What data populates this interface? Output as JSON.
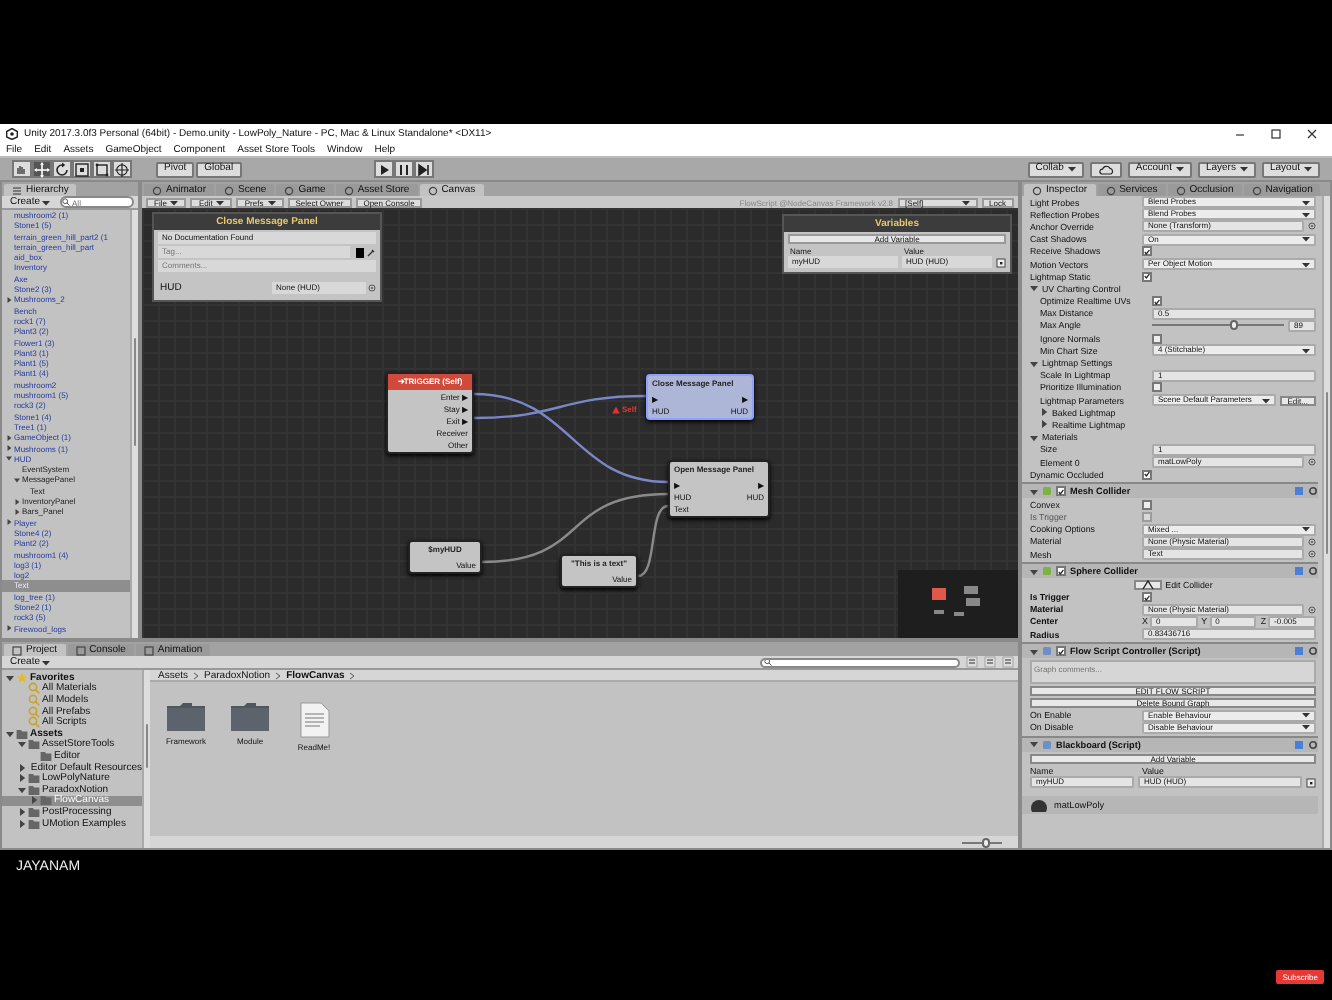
{
  "window": {
    "title": "Unity 2017.3.0f3 Personal (64bit) - Demo.unity - LowPoly_Nature - PC, Mac & Linux Standalone* <DX11>"
  },
  "menu": [
    "File",
    "Edit",
    "Assets",
    "GameObject",
    "Component",
    "Asset Store Tools",
    "Window",
    "Help"
  ],
  "toolbar": {
    "tools": [
      {
        "kind": "hand",
        "selected": false
      },
      {
        "kind": "move",
        "selected": true
      },
      {
        "kind": "rotate",
        "selected": false
      },
      {
        "kind": "scale",
        "selected": false
      },
      {
        "kind": "rect",
        "selected": false
      },
      {
        "kind": "transform",
        "selected": false
      }
    ],
    "toggles": [
      "Pivot",
      "Global"
    ],
    "menus": [
      "Collab",
      "Account",
      "Layers",
      "Layout"
    ]
  },
  "hierarchy": {
    "tab": "Hierarchy",
    "create": "Create",
    "search_placeholder": "All",
    "items": [
      {
        "label": "mushroom2 (1)",
        "selected": false
      },
      {
        "label": "Stone1 (5)",
        "selected": false
      },
      {
        "label": "terrain_green_hill_part2 (1",
        "selected": false
      },
      {
        "label": "terrain_green_hill_part",
        "selected": false
      },
      {
        "label": "aid_box",
        "selected": false
      },
      {
        "label": "Inventory",
        "selected": false
      },
      {
        "label": "Axe",
        "selected": false
      },
      {
        "label": "Stone2 (3)",
        "selected": false
      },
      {
        "label": "Mushrooms_2",
        "selected": false,
        "expanded": false
      },
      {
        "label": "Bench",
        "selected": false
      },
      {
        "label": "rock1 (7)",
        "selected": false
      },
      {
        "label": "Plant3 (2)",
        "selected": false
      },
      {
        "label": "Flower1 (3)",
        "selected": false
      },
      {
        "label": "Plant3 (1)",
        "selected": false
      },
      {
        "label": "Plant1 (5)",
        "selected": false
      },
      {
        "label": "Plant1 (4)",
        "selected": false
      },
      {
        "label": "mushroom2",
        "selected": false
      },
      {
        "label": "mushroom1 (5)",
        "selected": false
      },
      {
        "label": "rock3 (2)",
        "selected": false
      },
      {
        "label": "Stone1 (4)",
        "selected": false
      },
      {
        "label": "Tree1 (1)",
        "selected": false
      },
      {
        "label": "GameObject (1)",
        "selected": false,
        "expanded": false
      },
      {
        "label": "Mushrooms (1)",
        "selected": false,
        "expanded": false
      },
      {
        "label": "HUD",
        "selected": false,
        "expanded": true,
        "children": [
          {
            "label": "EventSystem",
            "selected": false
          },
          {
            "label": "MessagePanel",
            "selected": false,
            "expanded": true,
            "children": [
              {
                "label": "Text",
                "selected": false
              }
            ]
          },
          {
            "label": "InventoryPanel",
            "selected": false,
            "expanded": false
          },
          {
            "label": "Bars_Panel",
            "selected": false,
            "expanded": false
          }
        ]
      },
      {
        "label": "Player",
        "selected": false,
        "expanded": false
      },
      {
        "label": "Stone4 (2)",
        "selected": false
      },
      {
        "label": "Plant2 (2)",
        "selected": false
      },
      {
        "label": "mushroom1 (4)",
        "selected": false
      },
      {
        "label": "log3 (1)",
        "selected": false
      },
      {
        "label": "log2",
        "selected": false
      },
      {
        "label": "Text",
        "selected": true
      },
      {
        "label": "log_tree (1)",
        "selected": false
      },
      {
        "label": "Stone2 (1)",
        "selected": false
      },
      {
        "label": "rock3 (5)",
        "selected": false
      },
      {
        "label": "Firewood_logs",
        "selected": false,
        "expanded": false
      }
    ]
  },
  "canvas": {
    "tabs": [
      {
        "label": "Animator",
        "selected": false
      },
      {
        "label": "Scene",
        "selected": false
      },
      {
        "label": "Game",
        "selected": false
      },
      {
        "label": "Asset Store",
        "selected": false
      },
      {
        "label": "Canvas",
        "selected": true
      }
    ],
    "menu": [
      "File",
      "Edit",
      "Prefs",
      "Select Owner",
      "Open Console"
    ],
    "graph_info": "FlowScript @NodeCanvas Framework v2.8",
    "owner": "[Self]",
    "lock": "Lock",
    "node_inspector": {
      "title": "Close Message Panel",
      "doc": "No Documentation Found",
      "tag_placeholder": "Tag...",
      "comments_placeholder": "Comments...",
      "param_label": "HUD",
      "param_value": "None (HUD)"
    },
    "variables": {
      "title": "Variables",
      "add": "Add Variable",
      "headers": [
        "Name",
        "Value"
      ],
      "rows": [
        {
          "name": "myHUD",
          "value": "HUD (HUD)"
        }
      ]
    },
    "nodes": [
      {
        "kind": "event",
        "title": "➔TRIGGER (Self)",
        "selected": false,
        "rows": [
          {
            "right": "Enter ▶"
          },
          {
            "right": "Stay ▶"
          },
          {
            "right": "Exit ▶"
          },
          {
            "right": "Receiver"
          },
          {
            "right": "Other"
          }
        ]
      },
      {
        "kind": "action",
        "title": "Close Message Panel",
        "selected": true,
        "error": "Self",
        "rows": [
          {
            "left": "▶",
            "right": "▶"
          },
          {
            "left": "HUD",
            "right": "HUD"
          }
        ]
      },
      {
        "kind": "action",
        "title": "Open Message Panel",
        "selected": false,
        "rows": [
          {
            "left": "▶",
            "right": "▶"
          },
          {
            "left": "HUD",
            "right": "HUD"
          },
          {
            "left": "Text"
          }
        ]
      },
      {
        "kind": "value",
        "title": "$myHUD",
        "selected": false,
        "rows": [
          {
            "right": "Value"
          }
        ]
      },
      {
        "kind": "value",
        "title": "\"This is a text\"",
        "selected": false,
        "rows": [
          {
            "right": "Value"
          }
        ]
      }
    ]
  },
  "project": {
    "tabs": [
      {
        "label": "Project",
        "selected": true
      },
      {
        "label": "Console",
        "selected": false
      },
      {
        "label": "Animation",
        "selected": false
      }
    ],
    "create": "Create",
    "tree": [
      {
        "label": "Favorites",
        "kind": "favorites",
        "expanded": true,
        "selected": false,
        "children": [
          {
            "label": "All Materials",
            "kind": "search",
            "selected": false
          },
          {
            "label": "All Models",
            "kind": "search",
            "selected": false
          },
          {
            "label": "All Prefabs",
            "kind": "search",
            "selected": false
          },
          {
            "label": "All Scripts",
            "kind": "search",
            "selected": false
          }
        ]
      },
      {
        "label": "Assets",
        "kind": "folder",
        "expanded": true,
        "selected": false,
        "children": [
          {
            "label": "AssetStoreTools",
            "kind": "folder",
            "expanded": true,
            "selected": false,
            "children": [
              {
                "label": "Editor",
                "kind": "folder",
                "selected": false
              }
            ]
          },
          {
            "label": "Editor Default Resources",
            "kind": "folder",
            "expanded": false,
            "selected": false
          },
          {
            "label": "LowPolyNature",
            "kind": "folder",
            "expanded": false,
            "selected": false
          },
          {
            "label": "ParadoxNotion",
            "kind": "folder",
            "expanded": true,
            "selected": false,
            "children": [
              {
                "label": "FlowCanvas",
                "kind": "folder",
                "expanded": false,
                "selected": true
              }
            ]
          },
          {
            "label": "PostProcessing",
            "kind": "folder",
            "expanded": false,
            "selected": false
          },
          {
            "label": "UMotion Examples",
            "kind": "folder",
            "expanded": false,
            "selected": false
          }
        ]
      }
    ],
    "breadcrumb": [
      "Assets",
      "ParadoxNotion",
      "FlowCanvas"
    ],
    "files": [
      {
        "name": "Framework",
        "kind": "folder"
      },
      {
        "name": "Module",
        "kind": "folder"
      },
      {
        "name": "ReadMe!",
        "kind": "document"
      }
    ],
    "icon_size": {
      "level": 0.6
    }
  },
  "inspector": {
    "tabs": [
      {
        "label": "Inspector",
        "selected": true
      },
      {
        "label": "Services",
        "selected": false
      },
      {
        "label": "Occlusion",
        "selected": false
      },
      {
        "label": "Navigation",
        "selected": false
      }
    ],
    "rows": [
      {
        "kind": "dropdown",
        "label": "Light Probes",
        "value": "Blend Probes"
      },
      {
        "kind": "dropdown",
        "label": "Reflection Probes",
        "value": "Blend Probes"
      },
      {
        "kind": "object",
        "label": "Anchor Override",
        "value": "None (Transform)"
      },
      {
        "kind": "dropdown",
        "label": "Cast Shadows",
        "value": "On"
      },
      {
        "kind": "check",
        "label": "Receive Shadows",
        "checked": true
      },
      {
        "kind": "dropdown",
        "label": "Motion Vectors",
        "value": "Per Object Motion"
      },
      {
        "kind": "check",
        "label": "Lightmap Static",
        "checked": true
      },
      {
        "kind": "foldout",
        "label": "UV Charting Control",
        "expanded": true,
        "children": [
          {
            "kind": "check",
            "label": "Optimize Realtime UVs",
            "checked": true
          },
          {
            "kind": "field",
            "label": "Max Distance",
            "value": "0.5"
          },
          {
            "kind": "slider",
            "label": "Max Angle",
            "value": "89",
            "level": 0.62
          },
          {
            "kind": "check",
            "label": "Ignore Normals",
            "checked": false
          },
          {
            "kind": "dropdown",
            "label": "Min Chart Size",
            "value": "4 (Stitchable)"
          }
        ]
      },
      {
        "kind": "foldout",
        "label": "Lightmap Settings",
        "expanded": true,
        "children": [
          {
            "kind": "field",
            "label": "Scale In Lightmap",
            "value": "1"
          },
          {
            "kind": "check",
            "label": "Prioritize Illumination",
            "checked": false
          },
          {
            "kind": "dropdown",
            "label": "Lightmap Parameters",
            "value": "Scene Default Parameters",
            "button": "Edit..."
          },
          {
            "kind": "foldout",
            "label": "Baked Lightmap",
            "expanded": false
          },
          {
            "kind": "foldout",
            "label": "Realtime Lightmap",
            "expanded": false
          }
        ]
      },
      {
        "kind": "foldout",
        "label": "Materials",
        "expanded": true,
        "children": [
          {
            "kind": "field",
            "label": "Size",
            "value": "1"
          },
          {
            "kind": "object",
            "label": "Element 0",
            "value": "matLowPoly"
          }
        ]
      },
      {
        "kind": "check",
        "label": "Dynamic Occluded",
        "checked": true
      },
      {
        "kind": "component",
        "label": "Mesh Collider",
        "enabled": true,
        "children": [
          {
            "kind": "check",
            "label": "Convex",
            "checked": false
          },
          {
            "kind": "check",
            "label": "Is Trigger",
            "checked": false,
            "disabled": true
          },
          {
            "kind": "dropdown",
            "label": "Cooking Options",
            "value": "Mixed ..."
          },
          {
            "kind": "object",
            "label": "Material",
            "value": "None (Physic Material)"
          },
          {
            "kind": "object",
            "label": "Mesh",
            "value": "Text"
          }
        ]
      },
      {
        "kind": "component",
        "label": "Sphere Collider",
        "enabled": true,
        "children": [
          {
            "kind": "edit",
            "label": "Edit Collider"
          },
          {
            "kind": "check",
            "label": "Is Trigger",
            "checked": true,
            "modified": true
          },
          {
            "kind": "object",
            "label": "Material",
            "value": "None (Physic Material)",
            "modified": true
          },
          {
            "kind": "vector",
            "label": "Center",
            "modified": true,
            "values": [
              {
                "axis": "X",
                "value": "0"
              },
              {
                "axis": "Y",
                "value": "0"
              },
              {
                "axis": "Z",
                "value": "-0.005"
              }
            ]
          },
          {
            "kind": "field",
            "label": "Radius",
            "value": "0.83436716",
            "modified": true
          }
        ]
      },
      {
        "kind": "component",
        "label": "Flow Script Controller (Script)",
        "enabled": true,
        "children": [
          {
            "kind": "textarea",
            "placeholder": "Graph comments..."
          },
          {
            "kind": "button",
            "label": "EDIT FLOW SCRIPT"
          },
          {
            "kind": "button",
            "label": "Delete Bound Graph"
          },
          {
            "kind": "dropdown",
            "label": "On Enable",
            "value": "Enable Behaviour"
          },
          {
            "kind": "dropdown",
            "label": "On Disable",
            "value": "Disable Behaviour"
          }
        ]
      },
      {
        "kind": "component",
        "label": "Blackboard (Script)",
        "children": [
          {
            "kind": "button",
            "label": "Add Variable"
          },
          {
            "kind": "headers",
            "values": [
              "Name",
              "Value"
            ]
          },
          {
            "kind": "variable",
            "label": "myHUD",
            "value": "HUD (HUD)"
          }
        ]
      },
      {
        "kind": "asset",
        "label": "matLowPoly"
      }
    ]
  },
  "player": {
    "channel": "JAYANAM",
    "subscribe": "Subscribe"
  }
}
